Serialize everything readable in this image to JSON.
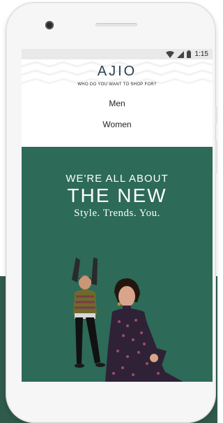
{
  "status_bar": {
    "time": "1:15"
  },
  "brand": {
    "name": "AJIO",
    "tagline": "WHO DO YOU WANT TO SHOP FOR?"
  },
  "options": [
    {
      "label": "Men"
    },
    {
      "label": "Women"
    }
  ],
  "banner": {
    "line1": "WE'RE ALL ABOUT",
    "line2": "THE NEW",
    "line3": "Style. Trends. You."
  },
  "colors": {
    "banner_bg": "#2d6a58",
    "brand_text": "#2c4152",
    "page_bottom_bg": "#2f5a4c"
  }
}
